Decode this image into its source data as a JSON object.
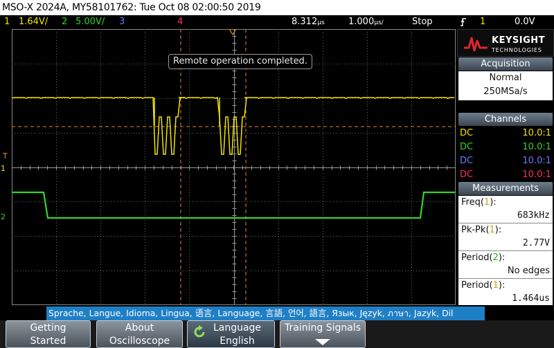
{
  "titlebar": {
    "text": "MSO-X 2024A, MY58101762: Tue Oct 08 02:00:50 2019"
  },
  "status": {
    "ch1_num": "1",
    "ch1_scale": "1.64V/",
    "ch2_num": "2",
    "ch2_scale": "5.00V/",
    "ch3_num": "3",
    "ch4_num": "4",
    "time_ref": "8.312",
    "time_ref_unit": "µs",
    "time_scale": "1.000",
    "time_scale_unit": "µs/",
    "run_state": "Stop",
    "trigger_icon": "trigger-edge-icon",
    "trigger_source": "1",
    "trigger_level": "0.0V"
  },
  "colors": {
    "ch1": "#f2e600",
    "ch2": "#34d52a",
    "ch3": "#6b7bff",
    "ch4": "#ff2a6a",
    "cursor": "#e08a2a"
  },
  "notification": "Remote operation completed.",
  "markers": {
    "ch1": "1",
    "ch2": "2",
    "trigger": "T"
  },
  "logo": {
    "brand": "KEYSIGHT",
    "sub": "TECHNOLOGIES",
    "icon": "keysight-wave-icon"
  },
  "acquisition": {
    "title": "Acquisition",
    "mode": "Normal",
    "rate": "250MSa/s"
  },
  "channels": {
    "title": "Channels",
    "rows": [
      {
        "coupling": "DC",
        "ratio": "10.0:1"
      },
      {
        "coupling": "DC",
        "ratio": "10.0:1"
      },
      {
        "coupling": "DC",
        "ratio": "10.0:1"
      },
      {
        "coupling": "DC",
        "ratio": "10.0:1"
      }
    ]
  },
  "measurements": {
    "title": "Measurements",
    "items": [
      {
        "label": "Freq",
        "source": "1",
        "value": "683kHz"
      },
      {
        "label": "Pk-Pk",
        "source": "1",
        "value": "2.77V"
      },
      {
        "label": "Period",
        "source": "2",
        "value": "No edges"
      },
      {
        "label": "Period",
        "source": "1",
        "value": "1.464us"
      }
    ]
  },
  "language_banner": "Sprache, Langue, Idioma, Lingua, 语言, Language, 言語, 언어, 語言, Язык, Język, ภาษา, Jazyk, Dil",
  "softkeys": [
    {
      "line1": "Getting",
      "line2": "Started"
    },
    {
      "line1": "About",
      "line2": "Oscilloscope"
    },
    {
      "line1": "Language",
      "line2": "English",
      "icon": "rotate-knob-icon"
    },
    {
      "line1": "Training Signals",
      "line2": "",
      "icon": "arrow-down-icon"
    }
  ]
}
